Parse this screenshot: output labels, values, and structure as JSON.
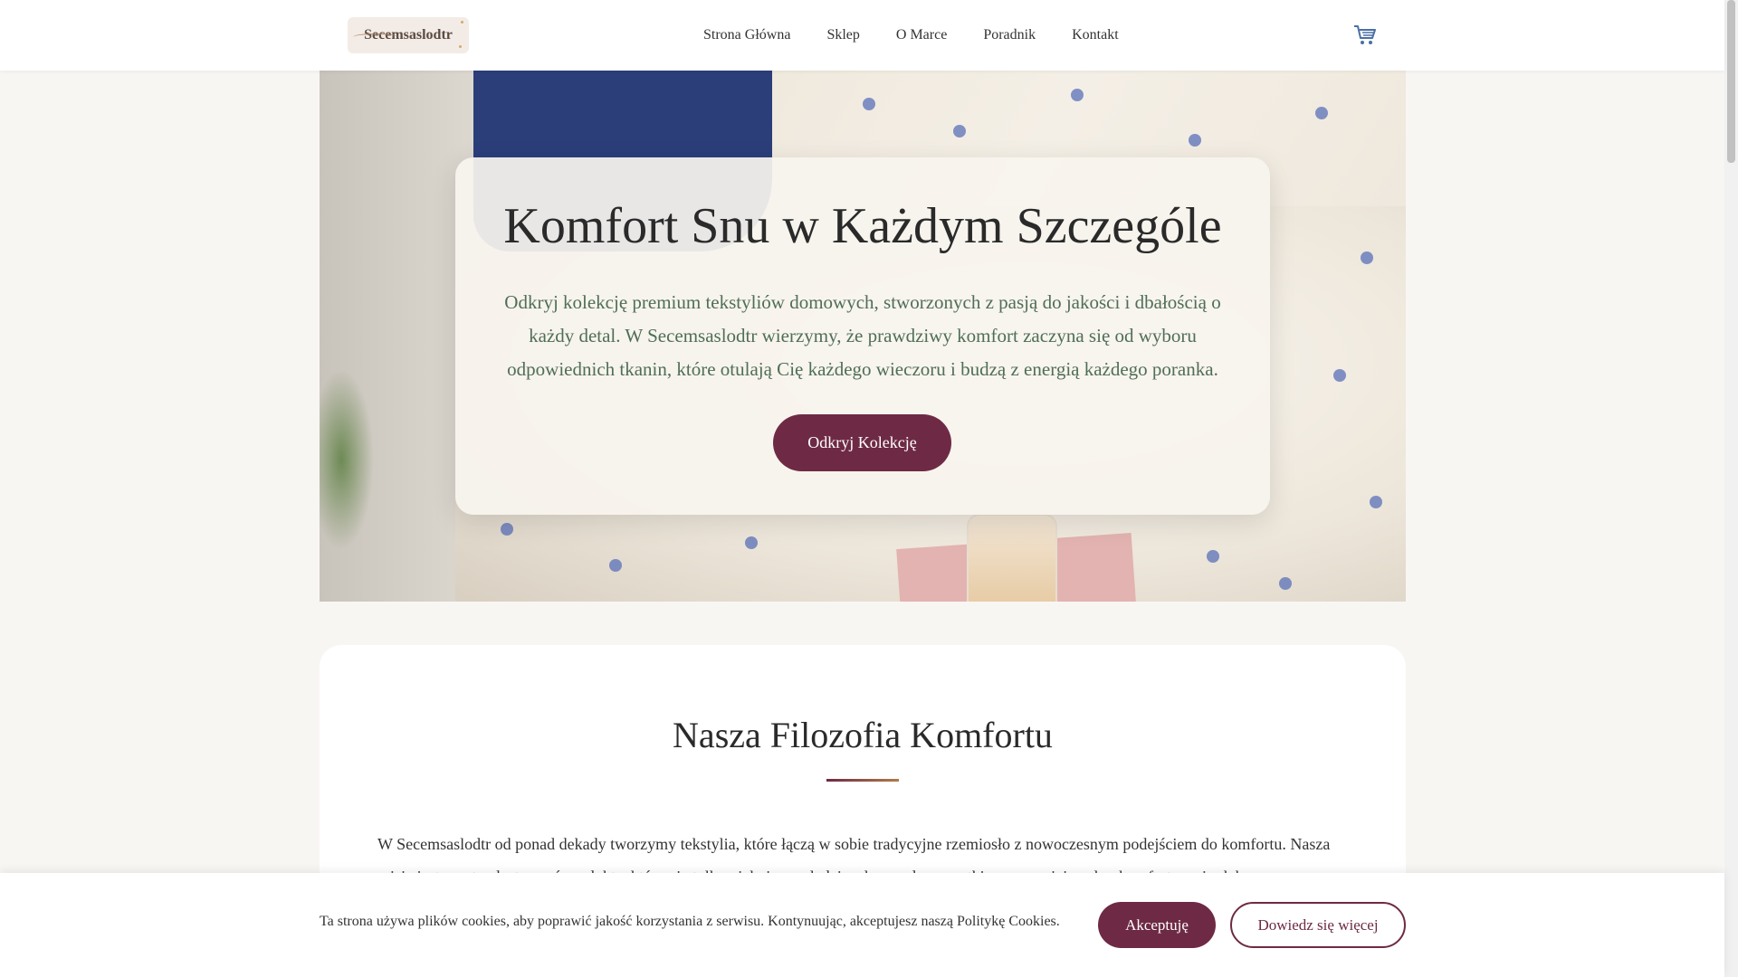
{
  "header": {
    "logo_text": "Secemsaslodtr",
    "nav": [
      {
        "label": "Strona Główna"
      },
      {
        "label": "Sklep"
      },
      {
        "label": "O Marce"
      },
      {
        "label": "Poradnik"
      },
      {
        "label": "Kontakt"
      }
    ],
    "cart_icon": "cart-icon"
  },
  "hero": {
    "title": "Komfort Snu w Każdym Szczególe",
    "text": "Odkryj kolekcję premium tekstyliów domowych, stworzonych z pasją do jakości i dbałością o każdy detal. W Secemsaslodtr wierzymy, że prawdziwy komfort zaczyna się od wyboru odpowiednich tkanin, które otulają Cię każdego wieczoru i budzą z energią każdego poranka.",
    "button_label": "Odkryj Kolekcję"
  },
  "philosophy": {
    "title": "Nasza Filozofia Komfortu",
    "text": "W Secemsaslodtr od ponad dekady tworzymy tekstylia, które łączą w sobie tradycyjne rzemiosło z nowoczesnym podejściem do komfortu. Nasza misja jest prosta: dostarczać produkty, które nie tylko pięknie wyglądają, ale przede wszystkim zapewniają pełny komfort snu i relaksu."
  },
  "cookie": {
    "text": "Ta strona używa plików cookies, aby poprawić jakość korzystania z serwisu. Kontynuując, akceptujesz naszą Politykę Cookies.",
    "accept_label": "Akceptuję",
    "more_label": "Dowiedz się więcej"
  },
  "colors": {
    "accent": "#6e2a44",
    "hero_text": "#4f6e57",
    "background": "#f8f6f3"
  }
}
